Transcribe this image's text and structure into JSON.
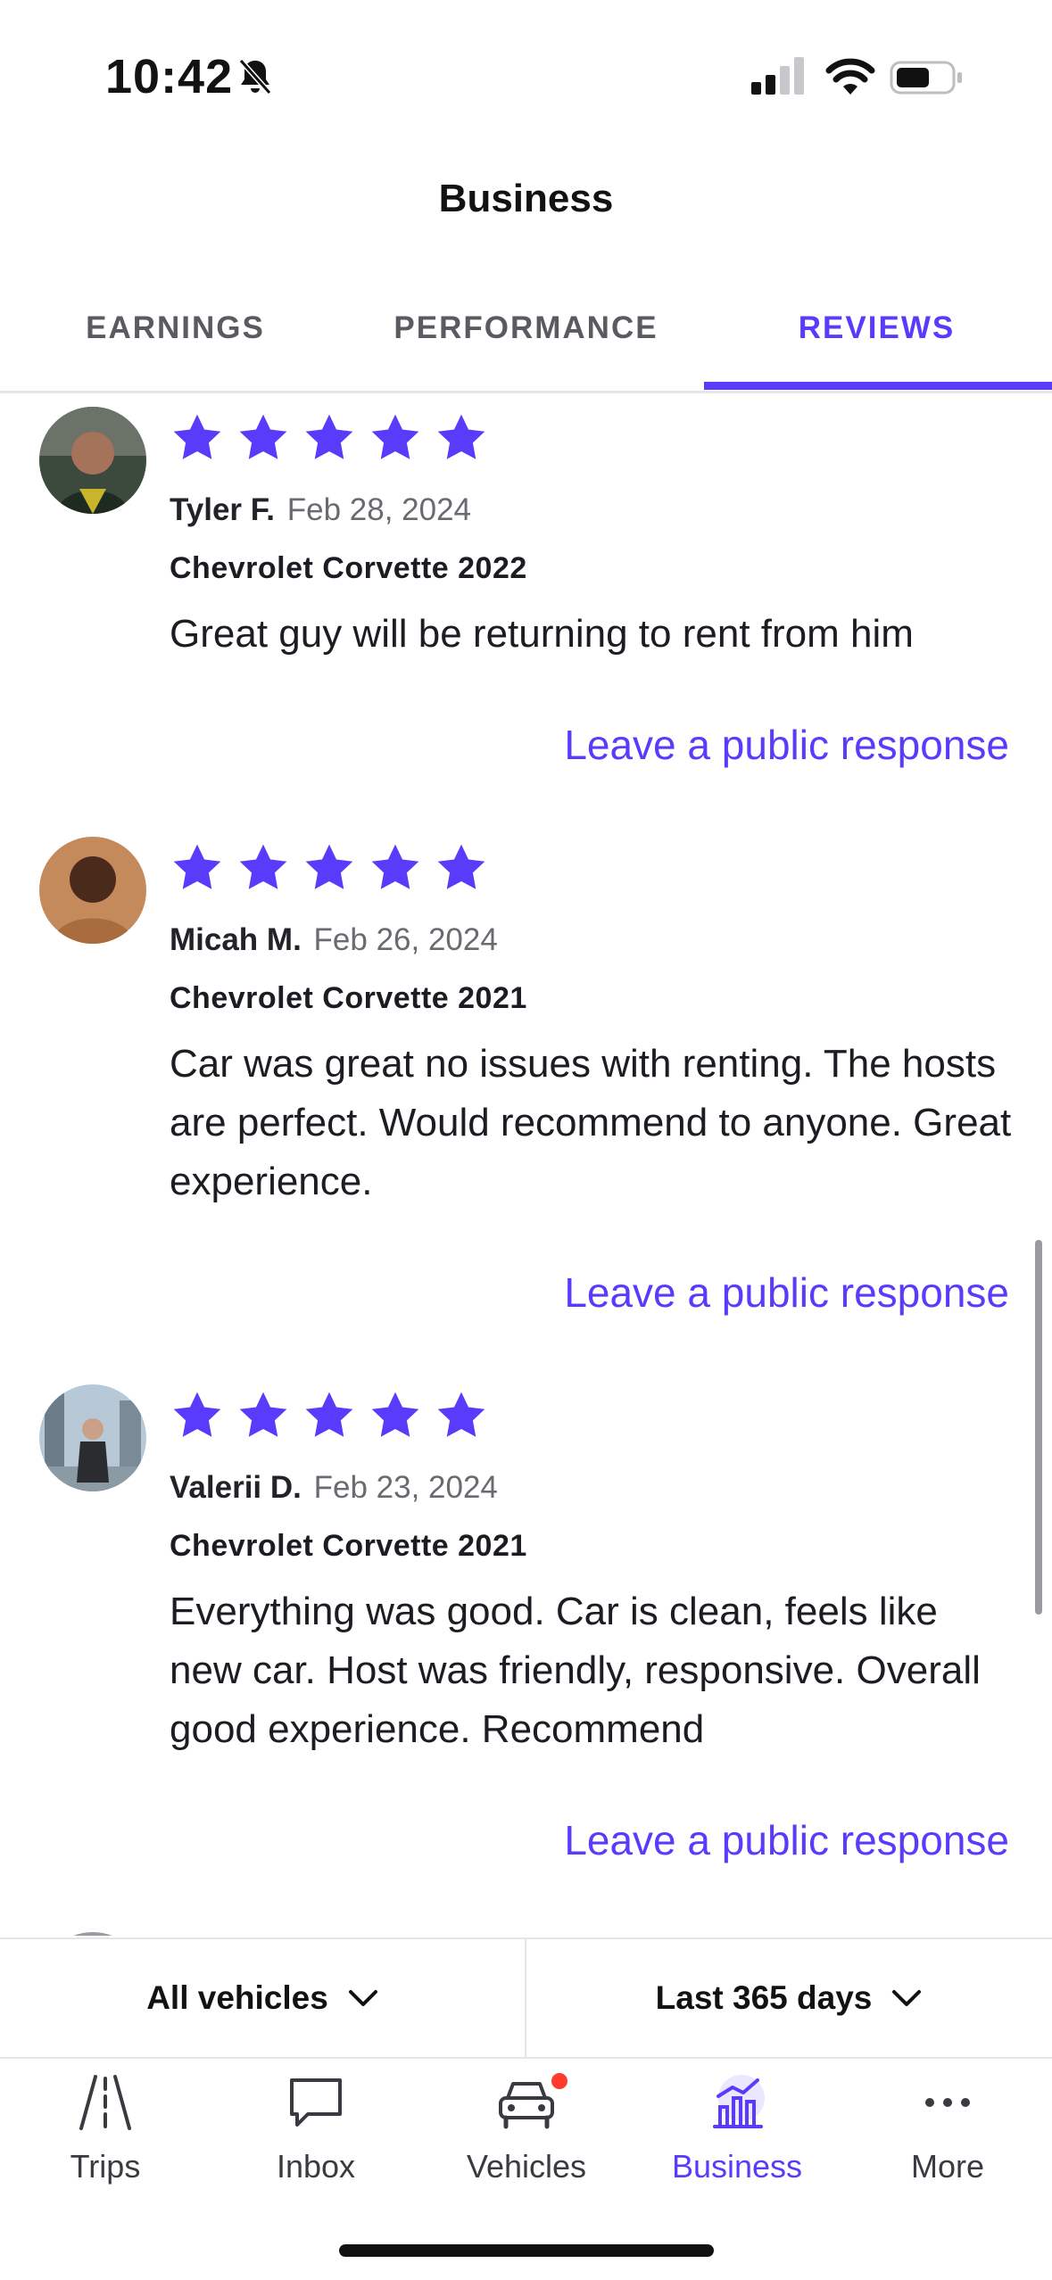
{
  "status": {
    "time": "10:42"
  },
  "header": {
    "title": "Business"
  },
  "tabs": [
    {
      "label": "EARNINGS",
      "active": false
    },
    {
      "label": "PERFORMANCE",
      "active": false
    },
    {
      "label": "REVIEWS",
      "active": true
    }
  ],
  "reviews": [
    {
      "rating": 5,
      "reviewer": "Tyler F.",
      "date": "Feb 28, 2024",
      "vehicle": "Chevrolet Corvette 2022",
      "text": "Great guy will be returning to rent from him",
      "response_label": "Leave a public response"
    },
    {
      "rating": 5,
      "reviewer": "Micah M.",
      "date": "Feb 26, 2024",
      "vehicle": "Chevrolet Corvette 2021",
      "text": "Car was great no issues with renting. The hosts are perfect. Would recommend to anyone. Great experience.",
      "response_label": "Leave a public response"
    },
    {
      "rating": 5,
      "reviewer": "Valerii D.",
      "date": "Feb 23, 2024",
      "vehicle": "Chevrolet Corvette 2021",
      "text": "Everything was good. Car is clean, feels like new car. Host was friendly, responsive. Overall good experience. Recommend",
      "response_label": "Leave a public response"
    }
  ],
  "filters": {
    "vehicles": "All vehicles",
    "period": "Last 365 days"
  },
  "nav": [
    {
      "label": "Trips",
      "icon": "road-icon"
    },
    {
      "label": "Inbox",
      "icon": "chat-bubble-icon"
    },
    {
      "label": "Vehicles",
      "icon": "car-icon",
      "badge": true
    },
    {
      "label": "Business",
      "icon": "bar-chart-icon",
      "active": true
    },
    {
      "label": "More",
      "icon": "more-dots-icon"
    }
  ],
  "colors": {
    "accent": "#593cfb",
    "star": "#593cfb",
    "badge": "#ff3b30"
  }
}
